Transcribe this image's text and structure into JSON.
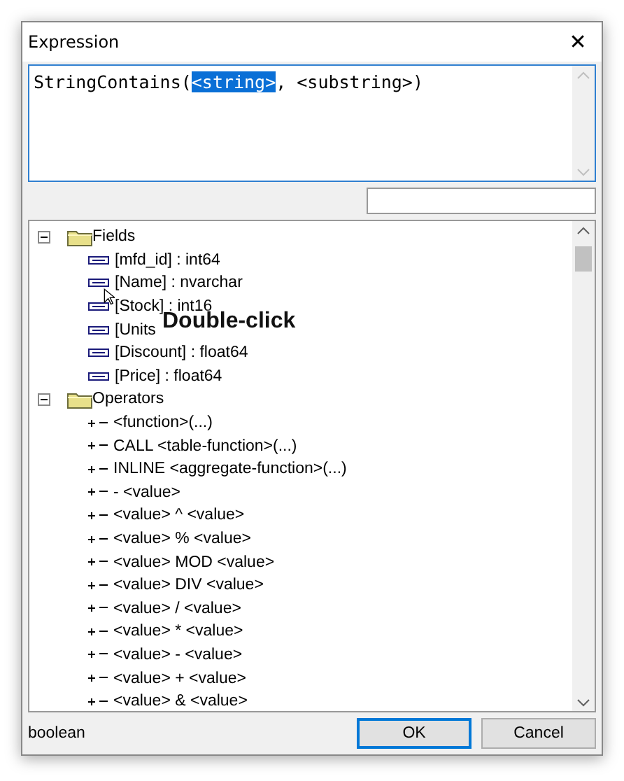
{
  "window": {
    "title": "Expression",
    "close_label": "✕"
  },
  "expression": {
    "before": "StringContains(",
    "selected": "<string>",
    "after": ", <substring>)"
  },
  "tree": [
    {
      "label": "Fields",
      "expanded": true,
      "children": [
        {
          "kind": "field",
          "label": "[mfd_id] : int64"
        },
        {
          "kind": "field",
          "label": "[Name] : nvarchar"
        },
        {
          "kind": "field",
          "label": "[Stock] : int16"
        },
        {
          "kind": "field",
          "label": "[Units"
        },
        {
          "kind": "field",
          "label": "[Discount] : float64"
        },
        {
          "kind": "field",
          "label": "[Price] : float64"
        }
      ]
    },
    {
      "label": "Operators",
      "expanded": true,
      "children": [
        {
          "kind": "operator",
          "label": "<function>(...)"
        },
        {
          "kind": "operator",
          "label": "CALL <table-function>(...)"
        },
        {
          "kind": "operator",
          "label": "INLINE <aggregate-function>(...)"
        },
        {
          "kind": "operator",
          "label": "- <value>"
        },
        {
          "kind": "operator",
          "label": "<value> ^ <value>"
        },
        {
          "kind": "operator",
          "label": "<value> % <value>"
        },
        {
          "kind": "operator",
          "label": "<value> MOD <value>"
        },
        {
          "kind": "operator",
          "label": "<value> DIV <value>"
        },
        {
          "kind": "operator",
          "label": "<value> / <value>"
        },
        {
          "kind": "operator",
          "label": "<value> * <value>"
        },
        {
          "kind": "operator",
          "label": "<value> - <value>"
        },
        {
          "kind": "operator",
          "label": "<value> + <value>"
        },
        {
          "kind": "operator",
          "label": "<value> & <value>"
        }
      ]
    }
  ],
  "overlay": {
    "caption": "Double-click"
  },
  "status": "boolean",
  "buttons": [
    {
      "label": "OK",
      "default": true
    },
    {
      "label": "Cancel",
      "default": false
    }
  ]
}
